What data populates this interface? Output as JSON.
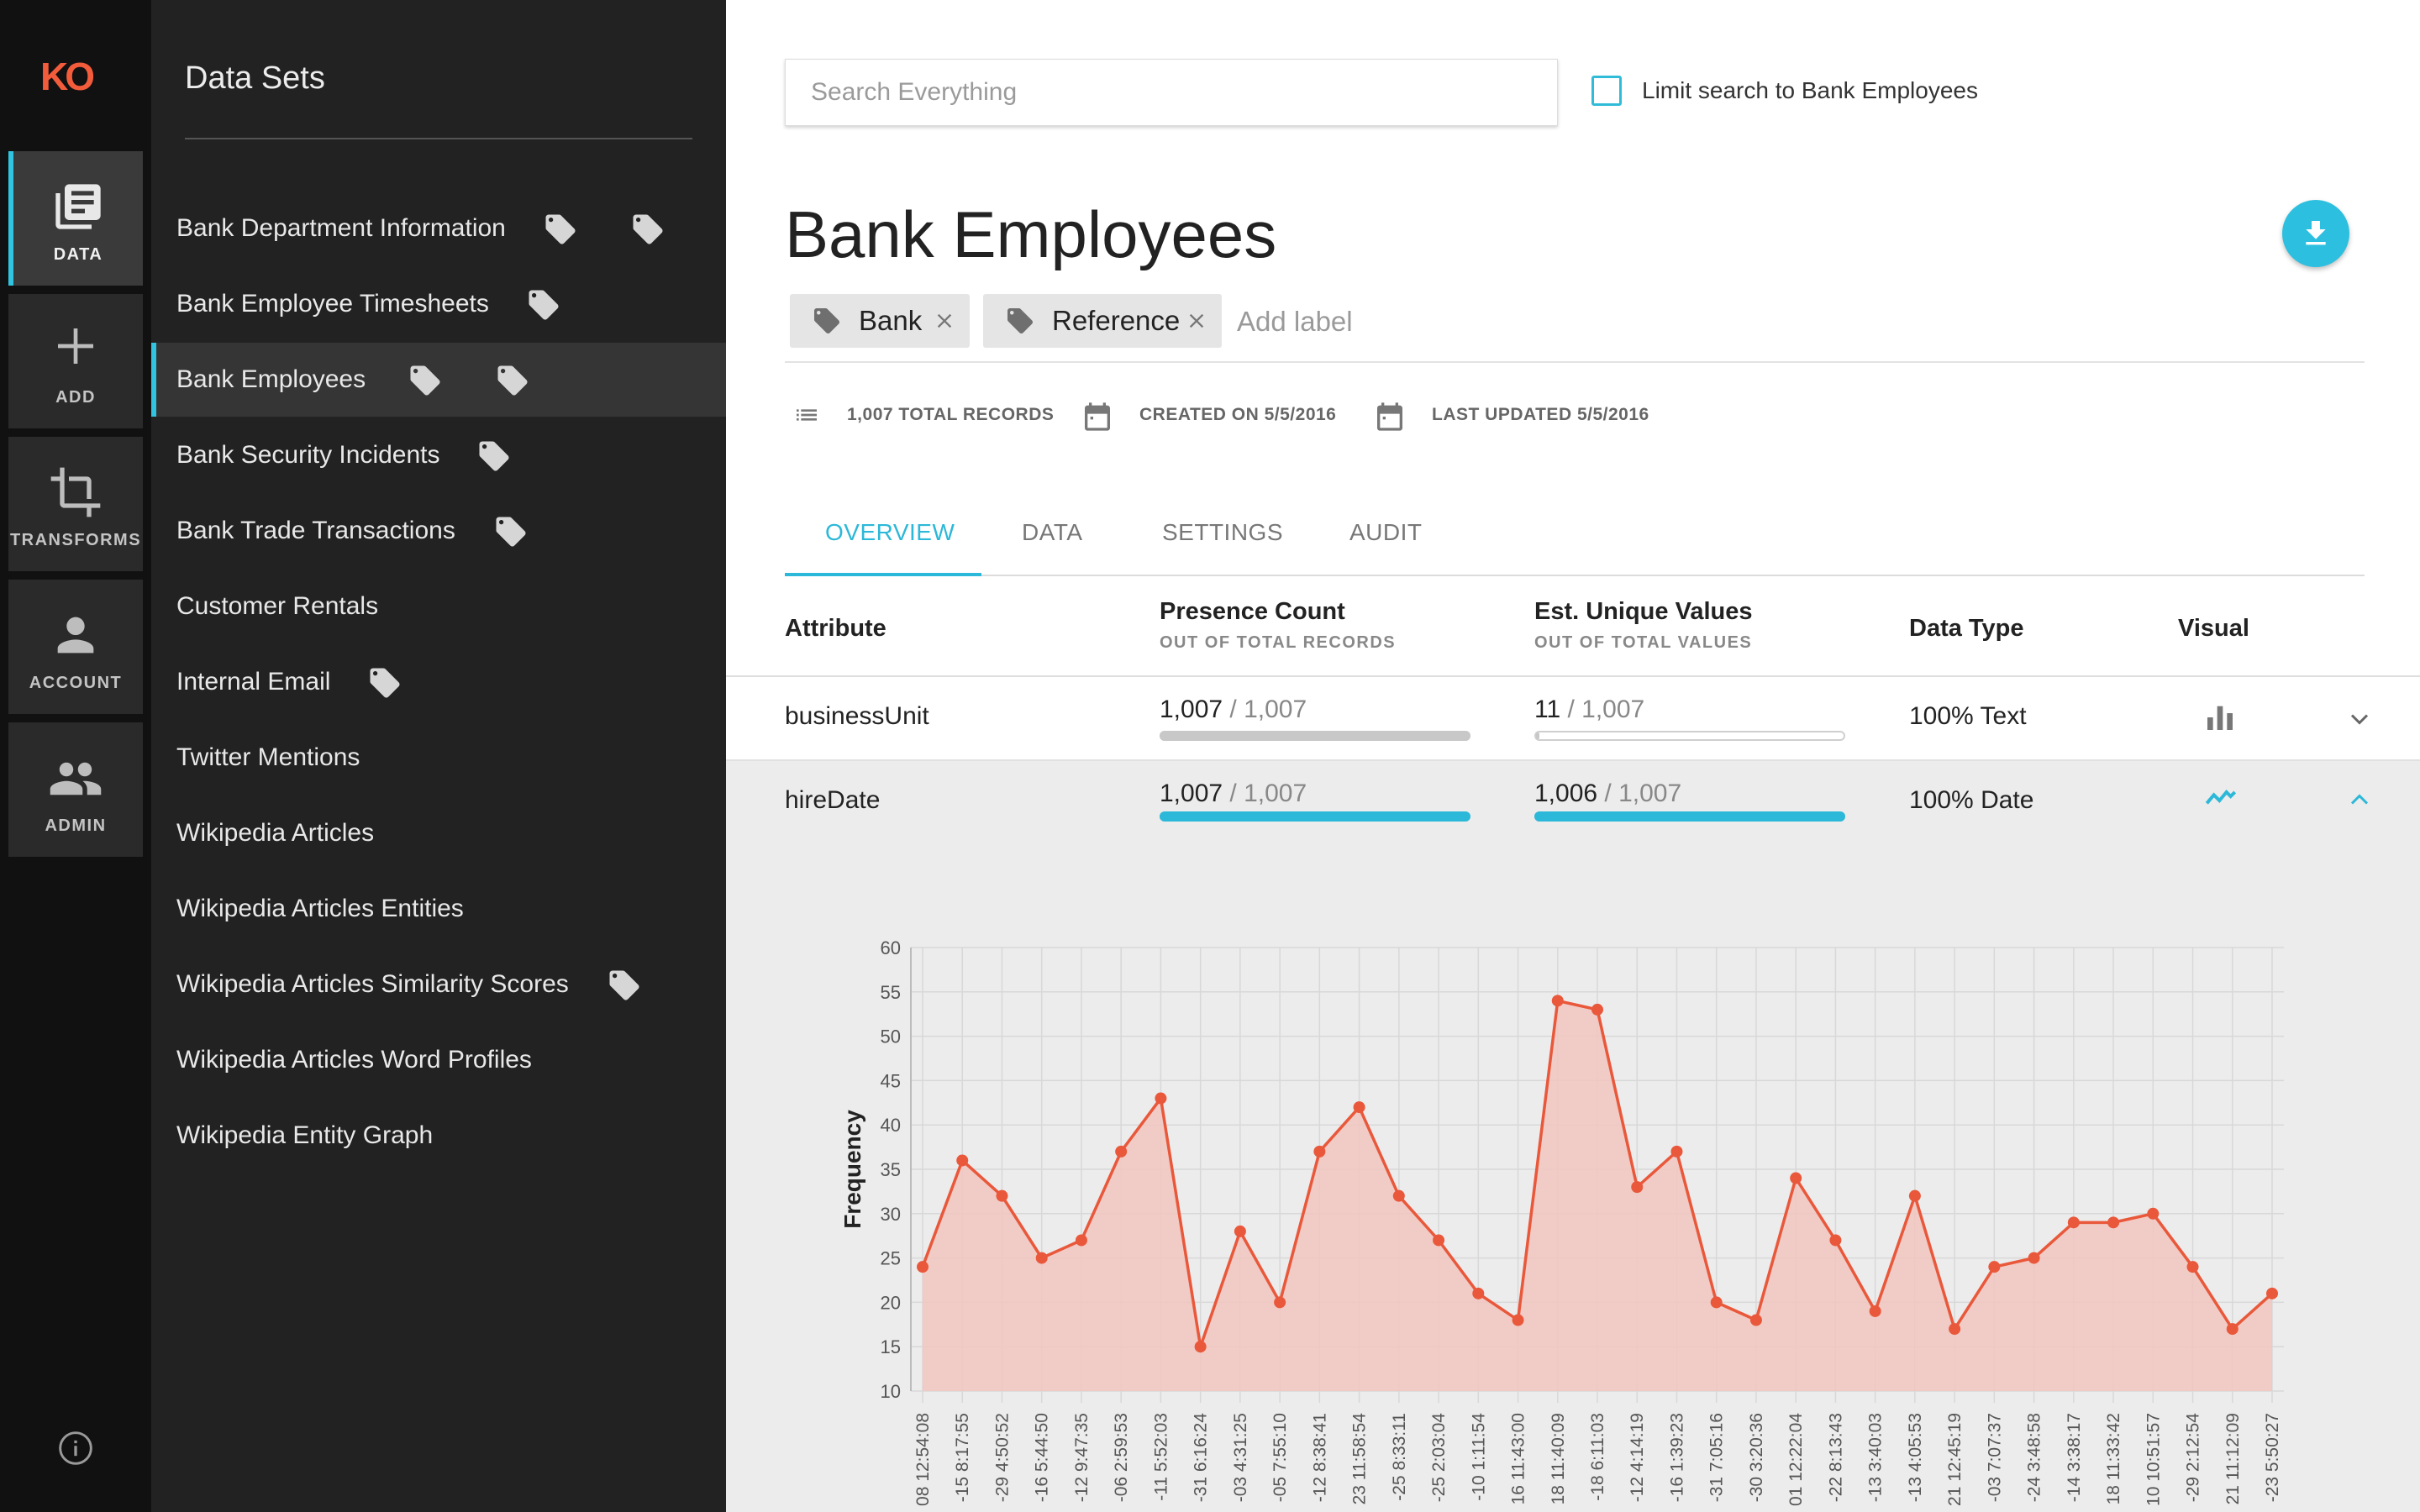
{
  "logo": "KO",
  "rail": [
    {
      "label": "DATA",
      "icon": "data-icon",
      "active": true
    },
    {
      "label": "ADD",
      "icon": "plus-icon",
      "active": false
    },
    {
      "label": "TRANSFORMS",
      "icon": "crop-icon",
      "active": false
    },
    {
      "label": "ACCOUNT",
      "icon": "person-icon",
      "active": false
    },
    {
      "label": "ADMIN",
      "icon": "people-icon",
      "active": false
    }
  ],
  "sidebar": {
    "title": "Data Sets",
    "items": [
      {
        "label": "Bank Department Information",
        "tags": 2
      },
      {
        "label": "Bank Employee Timesheets",
        "tags": 1
      },
      {
        "label": "Bank Employees",
        "tags": 2,
        "selected": true
      },
      {
        "label": "Bank Security Incidents",
        "tags": 1
      },
      {
        "label": "Bank Trade Transactions",
        "tags": 1
      },
      {
        "label": "Customer Rentals",
        "tags": 0
      },
      {
        "label": "Internal Email",
        "tags": 1
      },
      {
        "label": "Twitter Mentions",
        "tags": 0
      },
      {
        "label": "Wikipedia Articles",
        "tags": 0
      },
      {
        "label": "Wikipedia Articles Entities",
        "tags": 0
      },
      {
        "label": "Wikipedia Articles Similarity Scores",
        "tags": 1
      },
      {
        "label": "Wikipedia Articles Word Profiles",
        "tags": 0
      },
      {
        "label": "Wikipedia Entity Graph",
        "tags": 0
      }
    ]
  },
  "search": {
    "placeholder": "Search Everything",
    "limit_label": "Limit search to Bank Employees",
    "limit_checked": false
  },
  "dataset": {
    "title": "Bank Employees",
    "labels": [
      "Bank",
      "Reference"
    ],
    "add_label_placeholder": "Add label",
    "total_records": "1,007 TOTAL RECORDS",
    "created": "CREATED ON 5/5/2016",
    "updated": "LAST UPDATED 5/5/2016"
  },
  "tabs": [
    "OVERVIEW",
    "DATA",
    "SETTINGS",
    "AUDIT"
  ],
  "active_tab": "OVERVIEW",
  "table": {
    "headers": {
      "attribute": "Attribute",
      "presence": "Presence Count",
      "presence_sub": "OUT OF TOTAL RECORDS",
      "unique": "Est. Unique Values",
      "unique_sub": "OUT OF TOTAL VALUES",
      "type": "Data Type",
      "visual": "Visual"
    },
    "rows": [
      {
        "attribute": "businessUnit",
        "presence": "1,007",
        "presence_total": " / 1,007",
        "presence_frac": 1.0,
        "unique": "11",
        "unique_total": " / 1,007",
        "unique_frac": 0.011,
        "type": "100% Text",
        "visual_icon": "bar-chart-icon",
        "expanded": false
      },
      {
        "attribute": "hireDate",
        "presence": "1,007",
        "presence_total": " / 1,007",
        "presence_frac": 1.0,
        "unique": "1,006",
        "unique_total": " / 1,007",
        "unique_frac": 0.999,
        "type": "100% Date",
        "visual_icon": "line-chart-icon",
        "expanded": true
      }
    ]
  },
  "colors": {
    "accent": "#2cb8d8",
    "chart_line": "#e9583b",
    "chart_fill": "#f2c6be",
    "bar_gray": "#c8c8c8"
  },
  "chart_data": {
    "type": "area",
    "ylabel": "Frequency",
    "ylim": [
      10,
      60
    ],
    "yticks": [
      10,
      15,
      20,
      25,
      30,
      35,
      40,
      45,
      50,
      55,
      60
    ],
    "grid": true,
    "x": [
      "08 12:54:08",
      "-15 8:17:55",
      "-29 4:50:52",
      "-16 5:44:50",
      "-12 9:47:35",
      "-06 2:59:53",
      "-11 5:52:03",
      "-31 6:16:24",
      "-03 4:31:25",
      "-05 7:55:10",
      "-12 8:38:41",
      "23 11:58:54",
      "-25 8:33:11",
      "-25 2:03:04",
      "-10 1:11:54",
      "16 11:43:00",
      "18 11:40:09",
      "-18 6:11:03",
      "-12 4:14:19",
      "-16 1:39:23",
      "-31 7:05:16",
      "-30 3:20:36",
      "01 12:22:04",
      "-22 8:13:43",
      "-13 3:40:03",
      "-13 4:05:53",
      "21 12:45:19",
      "-03 7:07:37",
      "-24 3:48:58",
      "-14 3:38:17",
      "18 11:33:42",
      "10 10:51:57",
      "-29 2:12:54",
      "21 11:12:09",
      "-23 5:50:27"
    ],
    "values": [
      24,
      36,
      32,
      25,
      27,
      37,
      43,
      15,
      28,
      20,
      37,
      42,
      32,
      27,
      21,
      18,
      54,
      53,
      33,
      37,
      20,
      18,
      34,
      27,
      19,
      32,
      17,
      24,
      25,
      29,
      29,
      30,
      24,
      17,
      21
    ]
  }
}
